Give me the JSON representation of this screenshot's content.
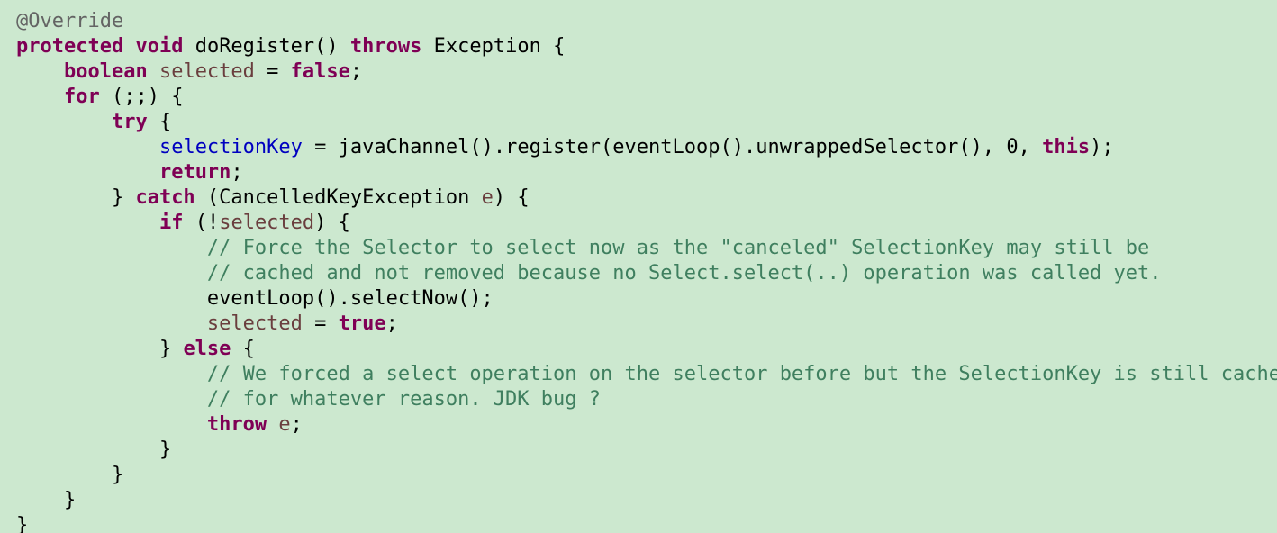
{
  "colors": {
    "background": "#cce8cf",
    "keyword": "#7f0055",
    "annotation": "#646464",
    "local_variable": "#6a3e3e",
    "field": "#0000c0",
    "comment": "#3f7f5f",
    "text": "#000000"
  },
  "code": {
    "lines": [
      [
        {
          "t": "@Override",
          "c": "ann"
        }
      ],
      [
        {
          "t": "protected",
          "c": "kw"
        },
        {
          "t": " ",
          "c": "txt"
        },
        {
          "t": "void",
          "c": "kw"
        },
        {
          "t": " doRegister() ",
          "c": "txt"
        },
        {
          "t": "throws",
          "c": "kw"
        },
        {
          "t": " Exception {",
          "c": "txt"
        }
      ],
      [
        {
          "t": "    ",
          "c": "txt"
        },
        {
          "t": "boolean",
          "c": "kw"
        },
        {
          "t": " ",
          "c": "txt"
        },
        {
          "t": "selected",
          "c": "var"
        },
        {
          "t": " = ",
          "c": "txt"
        },
        {
          "t": "false",
          "c": "kw"
        },
        {
          "t": ";",
          "c": "txt"
        }
      ],
      [
        {
          "t": "    ",
          "c": "txt"
        },
        {
          "t": "for",
          "c": "kw"
        },
        {
          "t": " (;;) {",
          "c": "txt"
        }
      ],
      [
        {
          "t": "        ",
          "c": "txt"
        },
        {
          "t": "try",
          "c": "kw"
        },
        {
          "t": " {",
          "c": "txt"
        }
      ],
      [
        {
          "t": "            ",
          "c": "txt"
        },
        {
          "t": "selectionKey",
          "c": "field"
        },
        {
          "t": " = javaChannel().register(eventLoop().unwrappedSelector(), 0, ",
          "c": "txt"
        },
        {
          "t": "this",
          "c": "kw"
        },
        {
          "t": ");",
          "c": "txt"
        }
      ],
      [
        {
          "t": "            ",
          "c": "txt"
        },
        {
          "t": "return",
          "c": "kw"
        },
        {
          "t": ";",
          "c": "txt"
        }
      ],
      [
        {
          "t": "        } ",
          "c": "txt"
        },
        {
          "t": "catch",
          "c": "kw"
        },
        {
          "t": " (CancelledKeyException ",
          "c": "txt"
        },
        {
          "t": "e",
          "c": "var"
        },
        {
          "t": ") {",
          "c": "txt"
        }
      ],
      [
        {
          "t": "            ",
          "c": "txt"
        },
        {
          "t": "if",
          "c": "kw"
        },
        {
          "t": " (!",
          "c": "txt"
        },
        {
          "t": "selected",
          "c": "var"
        },
        {
          "t": ") {",
          "c": "txt"
        }
      ],
      [
        {
          "t": "                ",
          "c": "txt"
        },
        {
          "t": "// Force the Selector to select now as the \"canceled\" SelectionKey may still be",
          "c": "cmt"
        }
      ],
      [
        {
          "t": "                ",
          "c": "txt"
        },
        {
          "t": "// cached and not removed because no Select.select(..) operation was called yet.",
          "c": "cmt"
        }
      ],
      [
        {
          "t": "                eventLoop().selectNow();",
          "c": "txt"
        }
      ],
      [
        {
          "t": "                ",
          "c": "txt"
        },
        {
          "t": "selected",
          "c": "var"
        },
        {
          "t": " = ",
          "c": "txt"
        },
        {
          "t": "true",
          "c": "kw"
        },
        {
          "t": ";",
          "c": "txt"
        }
      ],
      [
        {
          "t": "            } ",
          "c": "txt"
        },
        {
          "t": "else",
          "c": "kw"
        },
        {
          "t": " {",
          "c": "txt"
        }
      ],
      [
        {
          "t": "                ",
          "c": "txt"
        },
        {
          "t": "// We forced a select operation on the selector before but the SelectionKey is still cached",
          "c": "cmt"
        }
      ],
      [
        {
          "t": "                ",
          "c": "txt"
        },
        {
          "t": "// for whatever reason. JDK bug ?",
          "c": "cmt"
        }
      ],
      [
        {
          "t": "                ",
          "c": "txt"
        },
        {
          "t": "throw",
          "c": "kw"
        },
        {
          "t": " ",
          "c": "txt"
        },
        {
          "t": "e",
          "c": "var"
        },
        {
          "t": ";",
          "c": "txt"
        }
      ],
      [
        {
          "t": "            }",
          "c": "txt"
        }
      ],
      [
        {
          "t": "        }",
          "c": "txt"
        }
      ],
      [
        {
          "t": "    }",
          "c": "txt"
        }
      ],
      [
        {
          "t": "}",
          "c": "txt"
        }
      ]
    ]
  }
}
